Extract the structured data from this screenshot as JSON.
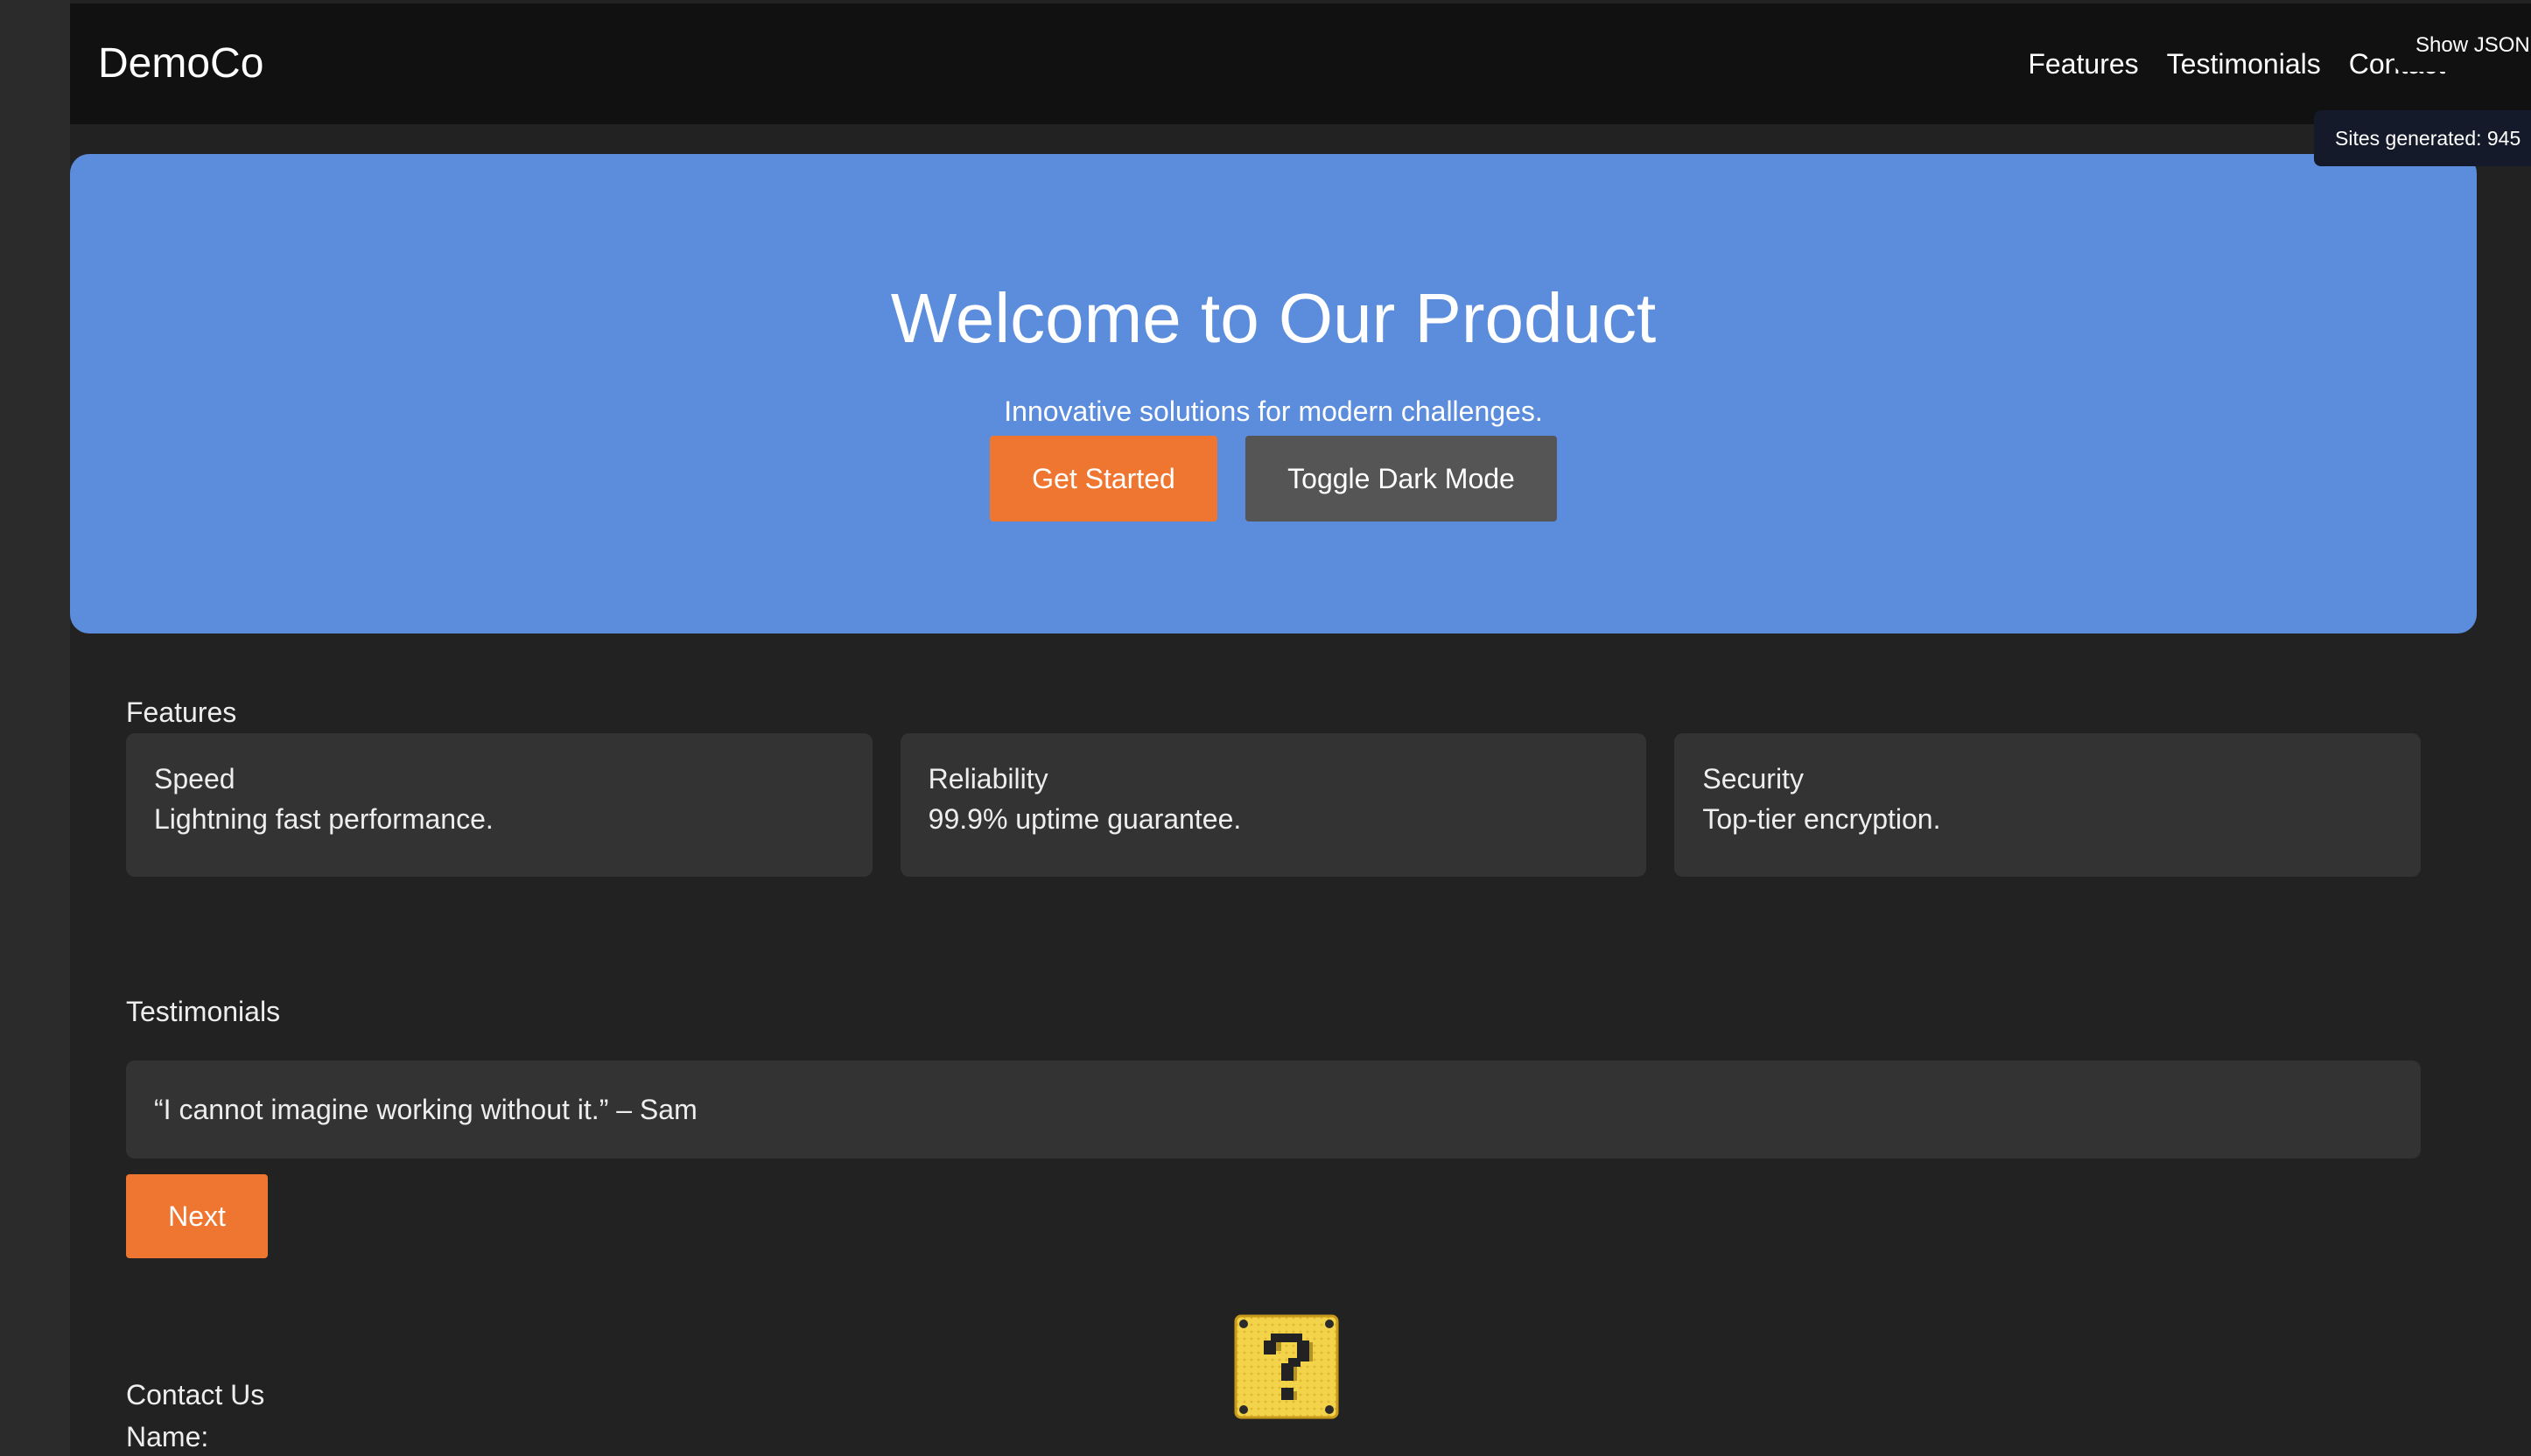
{
  "header": {
    "brand": "DemoCo",
    "nav": [
      "Features",
      "Testimonials",
      "Contact"
    ],
    "show_json_label": "Show JSON",
    "sites_generated_label": "Sites generated: 945"
  },
  "hero": {
    "title": "Welcome to Our Product",
    "subtitle": "Innovative solutions for modern challenges.",
    "primary_button": "Get Started",
    "secondary_button": "Toggle Dark Mode"
  },
  "features": {
    "heading": "Features",
    "items": [
      {
        "title": "Speed",
        "description": "Lightning fast performance."
      },
      {
        "title": "Reliability",
        "description": "99.9% uptime guarantee."
      },
      {
        "title": "Security",
        "description": "Top-tier encryption."
      }
    ]
  },
  "testimonials": {
    "heading": "Testimonials",
    "quote": "“I cannot imagine working without it.” – Sam",
    "next_button": "Next"
  },
  "contact": {
    "heading": "Contact Us",
    "name_label": "Name:"
  },
  "decorations": {
    "mystery_block_icon": "question-block-icon"
  },
  "colors": {
    "page_background": "#222222",
    "header_background": "#111111",
    "hero_background": "#5b8ddc",
    "accent": "#ef7630",
    "card_background": "#333333",
    "secondary_button": "#555555"
  }
}
